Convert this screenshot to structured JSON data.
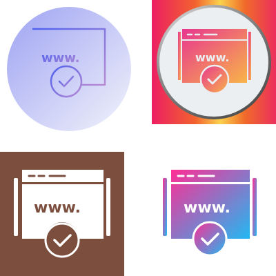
{
  "icons": [
    {
      "style": "line-gradient",
      "url_text": "www.",
      "colors": {
        "background_from": "#a4a8f4",
        "background_to": "#eceefb",
        "stroke_from": "#5566ee",
        "stroke_to": "#b08ad8"
      }
    },
    {
      "style": "gradient-filled",
      "url_text": "www.",
      "colors": {
        "frame": [
          "#ee2d6e",
          "#f26b3a",
          "#fbd14b"
        ],
        "fill_from": "#ea3a8a",
        "fill_to": "#f7b148",
        "ring": "#888888",
        "inner": "#eceff1"
      }
    },
    {
      "style": "glyph",
      "url_text": "www.",
      "colors": {
        "background": "#7b4e3d",
        "foreground": "#ffffff"
      }
    },
    {
      "style": "gradient-glyph",
      "url_text": "www.",
      "colors": {
        "fill_from": "#ff3b9a",
        "fill_to": "#2ab6f0",
        "foreground": "#ffffff"
      }
    }
  ]
}
